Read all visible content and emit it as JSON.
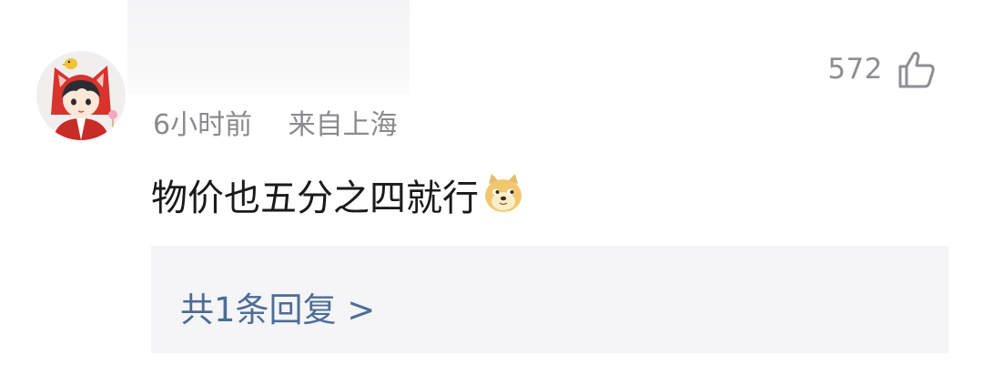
{
  "comment": {
    "like_count": "572",
    "time": "6小时前",
    "location": "来自上海",
    "text": "物价也五分之四就行",
    "emoji": "doge-emoji",
    "reply_link": "共1条回复 >"
  },
  "icons": {
    "like": "thumbs-up-icon",
    "avatar": "avatar"
  },
  "colors": {
    "meta_gray": "#8a8a8e",
    "reply_blue": "#4e6d96",
    "reply_bg": "#f5f5f7"
  }
}
